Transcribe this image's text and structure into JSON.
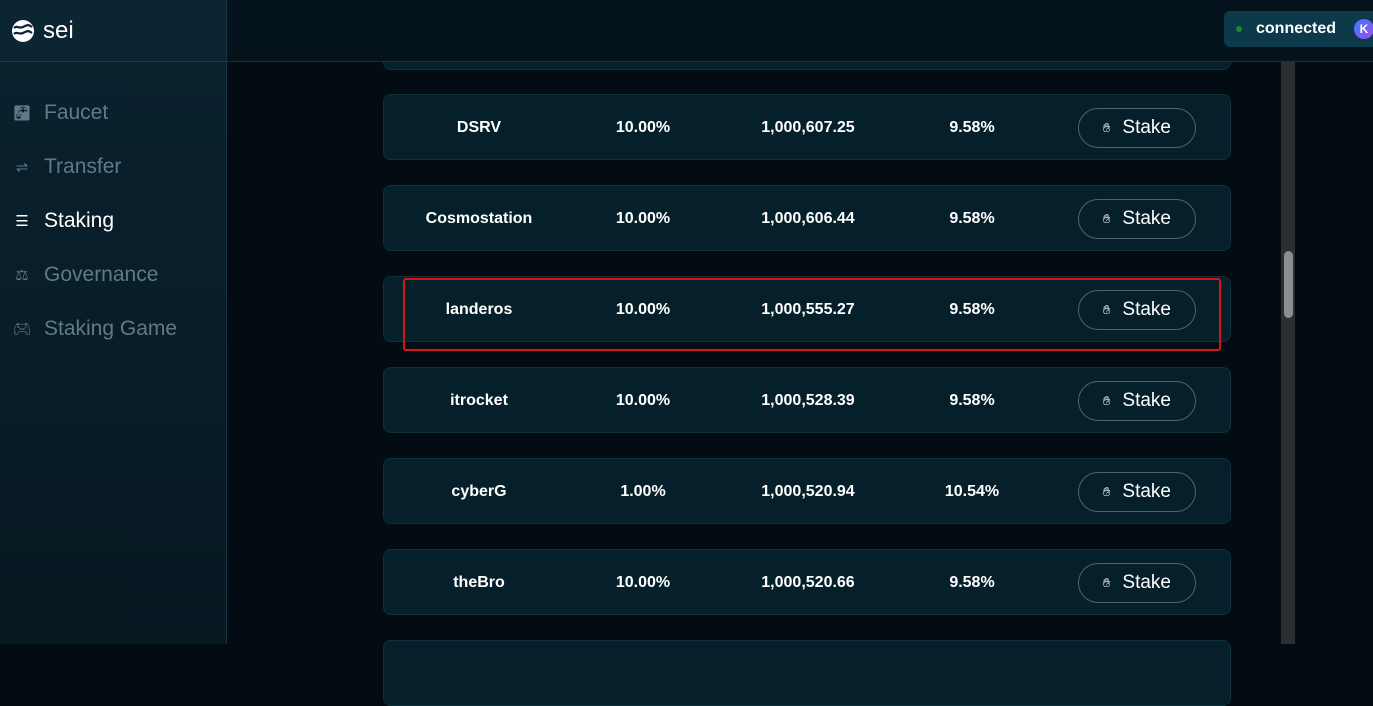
{
  "brand": "sei",
  "nav": [
    {
      "label": "Faucet",
      "icon": "faucet-icon",
      "active": false
    },
    {
      "label": "Transfer",
      "icon": "transfer-icon",
      "active": false
    },
    {
      "label": "Staking",
      "icon": "database-icon",
      "active": true
    },
    {
      "label": "Governance",
      "icon": "scale-icon",
      "active": false
    },
    {
      "label": "Staking Game",
      "icon": "gamepad-icon",
      "active": false
    }
  ],
  "wallet": {
    "status": "connected",
    "avatar": "K",
    "status_color": "#1d8b2a"
  },
  "validators": [
    {
      "name": "DSRV",
      "commission": "10.00%",
      "voting_power": "1,000,607.25",
      "apr": "9.58%",
      "action": "Stake"
    },
    {
      "name": "Cosmostation",
      "commission": "10.00%",
      "voting_power": "1,000,606.44",
      "apr": "9.58%",
      "action": "Stake"
    },
    {
      "name": "landeros",
      "commission": "10.00%",
      "voting_power": "1,000,555.27",
      "apr": "9.58%",
      "action": "Stake",
      "highlighted": true
    },
    {
      "name": "itrocket",
      "commission": "10.00%",
      "voting_power": "1,000,528.39",
      "apr": "9.58%",
      "action": "Stake"
    },
    {
      "name": "cyberG",
      "commission": "1.00%",
      "voting_power": "1,000,520.94",
      "apr": "10.54%",
      "action": "Stake"
    },
    {
      "name": "theBro",
      "commission": "10.00%",
      "voting_power": "1,000,520.66",
      "apr": "9.58%",
      "action": "Stake"
    }
  ],
  "highlight_color": "#d6141a"
}
